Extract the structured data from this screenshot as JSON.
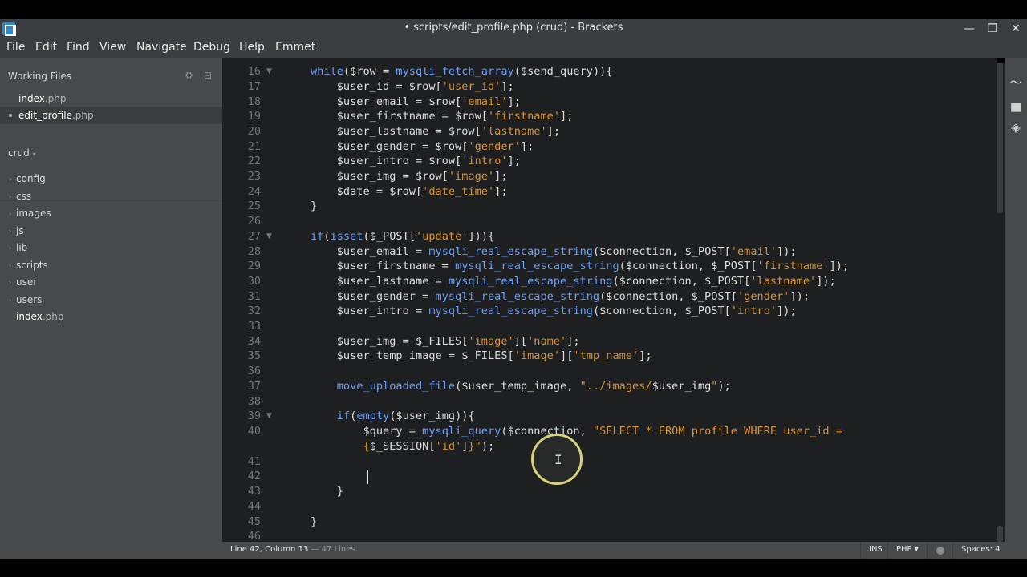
{
  "window": {
    "title": "• scripts/edit_profile.php (crud) - Brackets",
    "minimize": "—",
    "restore": "❐",
    "close": "✕"
  },
  "menu": [
    "File",
    "Edit",
    "Find",
    "View",
    "Navigate",
    "Debug",
    "Help",
    "Emmet"
  ],
  "sidebar": {
    "working_files_label": "Working Files",
    "working_files": [
      {
        "name": "index",
        "ext": ".php"
      },
      {
        "name": "edit_profile",
        "ext": ".php"
      }
    ],
    "project_label": "crud",
    "folders": [
      "config",
      "css",
      "images",
      "js",
      "lib",
      "scripts",
      "user",
      "users"
    ],
    "root_file": {
      "name": "index",
      "ext": ".php"
    }
  },
  "editor": {
    "line_numbers": [
      "16",
      "17",
      "18",
      "19",
      "20",
      "21",
      "22",
      "23",
      "24",
      "25",
      "26",
      "27",
      "28",
      "29",
      "30",
      "31",
      "32",
      "33",
      "34",
      "35",
      "36",
      "37",
      "38",
      "39",
      "40",
      "",
      "41",
      "42",
      "43",
      "44",
      "45",
      "46"
    ],
    "fold_markers": [
      "▼",
      "▼",
      "▼"
    ]
  },
  "statusbar": {
    "position": "Line 42, Column 13",
    "line_count": " — 47 Lines",
    "mode": "INS",
    "language": "PHP",
    "language_caret": "▾",
    "spaces": "Spaces: 4"
  },
  "colors": {
    "keyword": "#6c9ef8",
    "string": "#d89333",
    "text": "#dddddd",
    "editor_bg": "#1d1f21",
    "sidebar_bg": "#47494b"
  }
}
